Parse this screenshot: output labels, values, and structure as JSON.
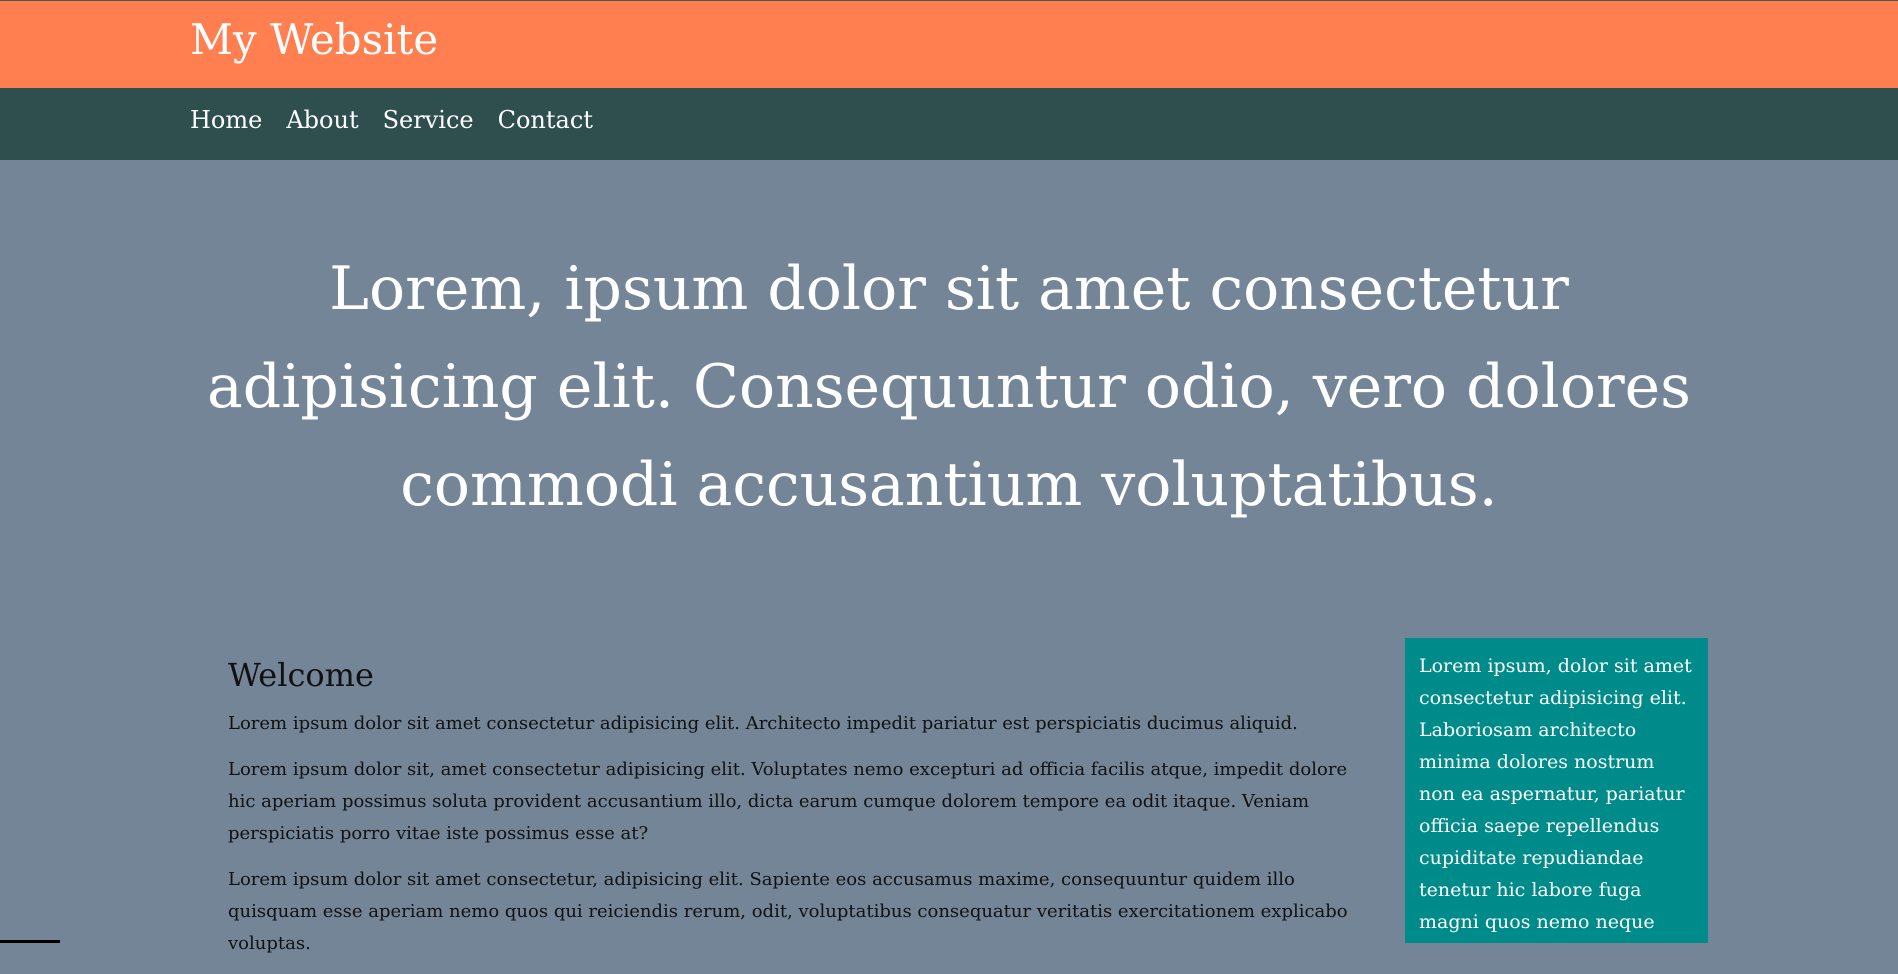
{
  "header": {
    "site_title": "My Website"
  },
  "nav": {
    "items": [
      {
        "label": "Home"
      },
      {
        "label": "About"
      },
      {
        "label": "Service"
      },
      {
        "label": "Contact"
      }
    ]
  },
  "hero": {
    "heading": "Lorem, ipsum dolor sit amet consectetur adipisicing elit. Consequuntur odio, vero dolores commodi accusantium voluptatibus."
  },
  "main": {
    "heading": "Welcome",
    "paragraphs": [
      "Lorem ipsum dolor sit amet consectetur adipisicing elit. Architecto impedit pariatur est perspiciatis ducimus aliquid.",
      "Lorem ipsum dolor sit, amet consectetur adipisicing elit. Voluptates nemo excepturi ad officia facilis atque, impedit dolore hic aperiam possimus soluta provident accusantium illo, dicta earum cumque dolorem tempore ea odit itaque. Veniam perspiciatis porro vitae iste possimus esse at?",
      "Lorem ipsum dolor sit amet consectetur, adipisicing elit. Sapiente eos accusamus maxime, consequuntur quidem illo quisquam esse aperiam nemo quos qui reiciendis rerum, odit, voluptatibus consequatur veritatis exercitationem explicabo voluptas."
    ]
  },
  "sidebar": {
    "text": "Lorem ipsum, dolor sit amet consectetur adipisicing elit. Laboriosam architecto minima dolores nostrum non ea aspernatur, pariatur officia saepe repellendus cupiditate repudiandae tenetur hic labore fuga magni quos nemo neque accusamus. Incidunt laboriosam"
  },
  "colors": {
    "header_bg": "#ff7f50",
    "nav_bg": "#2f4f4f",
    "page_bg": "#738596",
    "sidebar_bg": "#008b8b"
  }
}
